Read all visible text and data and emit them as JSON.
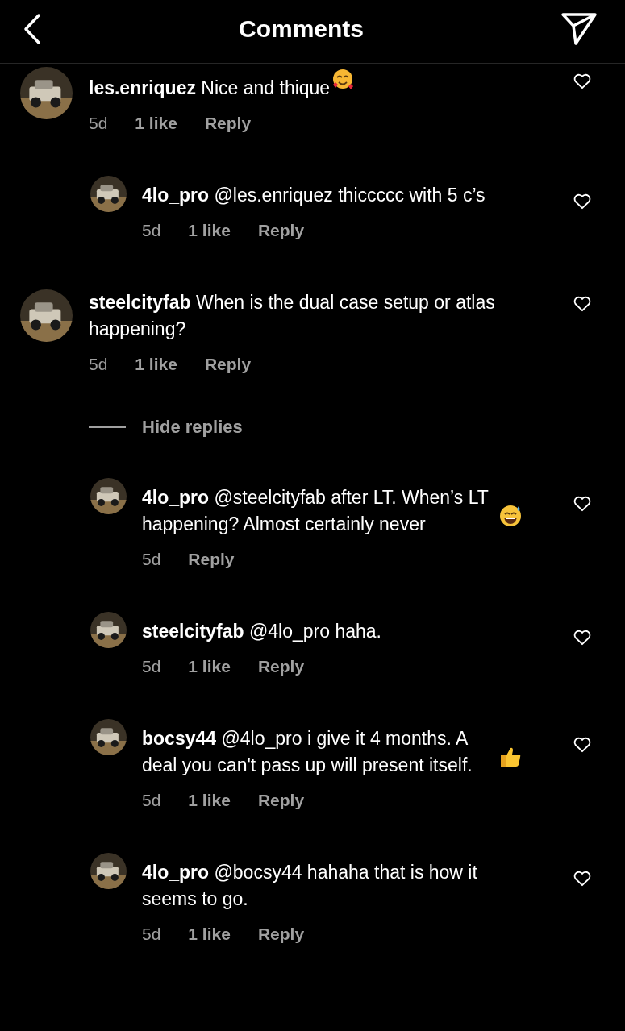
{
  "header": {
    "title": "Comments"
  },
  "comments": [
    {
      "text": "**les.enriquez** Nice and thique",
      "emoji": {
        "kind": "smiling-hearts"
      },
      "time": "5d",
      "likes": "1 like",
      "reply": "Reply",
      "children": [
        {
          "text": "**4lo_pro** @les.enriquez thiccccc with 5 c’s",
          "time": "5d",
          "likes": "1 like",
          "reply": "Reply"
        }
      ]
    },
    {
      "text": "**steelcityfab** When is the dual case setup or atlas happening?",
      "time": "5d",
      "likes": "1 like",
      "reply": "Reply",
      "replies_toggle": "Hide replies",
      "children": [
        {
          "text": "**4lo_pro** @steelcityfab after LT. When’s LT happening? Almost certainly never",
          "emoji": {
            "kind": "sweat-smile"
          },
          "time": "5d",
          "reply": "Reply"
        },
        {
          "text": "**steelcityfab** @4lo_pro haha.",
          "time": "5d",
          "likes": "1 like",
          "reply": "Reply"
        },
        {
          "text": "**bocsy44** @4lo_pro i give it 4 months. A deal you can't pass up will present itself.",
          "emoji": {
            "kind": "thumbs-up"
          },
          "time": "5d",
          "likes": "1 like",
          "reply": "Reply"
        },
        {
          "text": "**4lo_pro** @bocsy44 hahaha that is how it seems to go.",
          "time": "5d",
          "likes": "1 like",
          "reply": "Reply"
        }
      ]
    }
  ]
}
